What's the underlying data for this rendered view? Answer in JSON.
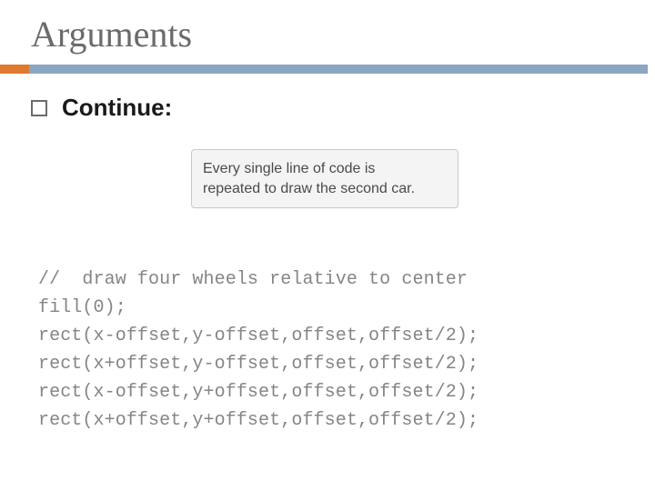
{
  "title": "Arguments",
  "bullet": {
    "label": "Continue:"
  },
  "callout": {
    "line1": "Every single line of code is",
    "line2": "repeated to draw the second car."
  },
  "code": {
    "lines": [
      "//  draw four wheels relative to center",
      "fill(0);",
      "rect(x-offset,y-offset,offset,offset/2);",
      "rect(x+offset,y-offset,offset,offset/2);",
      "rect(x-offset,y+offset,offset,offset/2);",
      "rect(x+offset,y+offset,offset,offset/2);"
    ]
  }
}
